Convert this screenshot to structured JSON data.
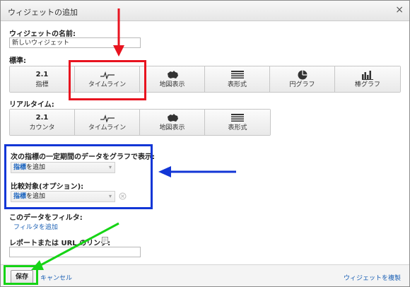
{
  "dialog": {
    "title": "ウィジェットの追加",
    "close_label": "×"
  },
  "widget_name": {
    "label": "ウィジェットの名前:",
    "value": "新しいウィジェット"
  },
  "standard": {
    "label": "標準:",
    "buttons": [
      {
        "num": "2.1",
        "label": "指標",
        "icon": "number-icon"
      },
      {
        "label": "タイムライン",
        "icon": "timeline-icon"
      },
      {
        "label": "地図表示",
        "icon": "map-icon"
      },
      {
        "label": "表形式",
        "icon": "table-icon"
      },
      {
        "label": "円グラフ",
        "icon": "pie-chart-icon"
      },
      {
        "label": "棒グラフ",
        "icon": "bar-chart-icon"
      }
    ]
  },
  "realtime": {
    "label": "リアルタイム:",
    "buttons": [
      {
        "num": "2.1",
        "label": "カウンタ",
        "icon": "number-icon"
      },
      {
        "label": "タイムライン",
        "icon": "timeline-icon"
      },
      {
        "label": "地図表示",
        "icon": "map-icon"
      },
      {
        "label": "表形式",
        "icon": "table-icon"
      }
    ]
  },
  "graph": {
    "label": "次の指標の一定期間のデータをグラフで表示:",
    "metric_dropdown": {
      "highlight": "指標",
      "rest": "を追加"
    },
    "compare_label": "比較対象(オプション):",
    "compare_dropdown": {
      "highlight": "指標",
      "rest": "を追加"
    }
  },
  "filter": {
    "label": "このデータをフィルタ:",
    "link": "フィルタを追加"
  },
  "report_link": {
    "label": "レポートまたは URL のリンク:",
    "value": ""
  },
  "footer": {
    "save": "保存",
    "cancel": "キャンセル",
    "clone": "ウィジェットを複製"
  },
  "colors": {
    "red": "#e8131f",
    "blue": "#1236d6",
    "green": "#16d416",
    "link": "#1a5fb4"
  }
}
